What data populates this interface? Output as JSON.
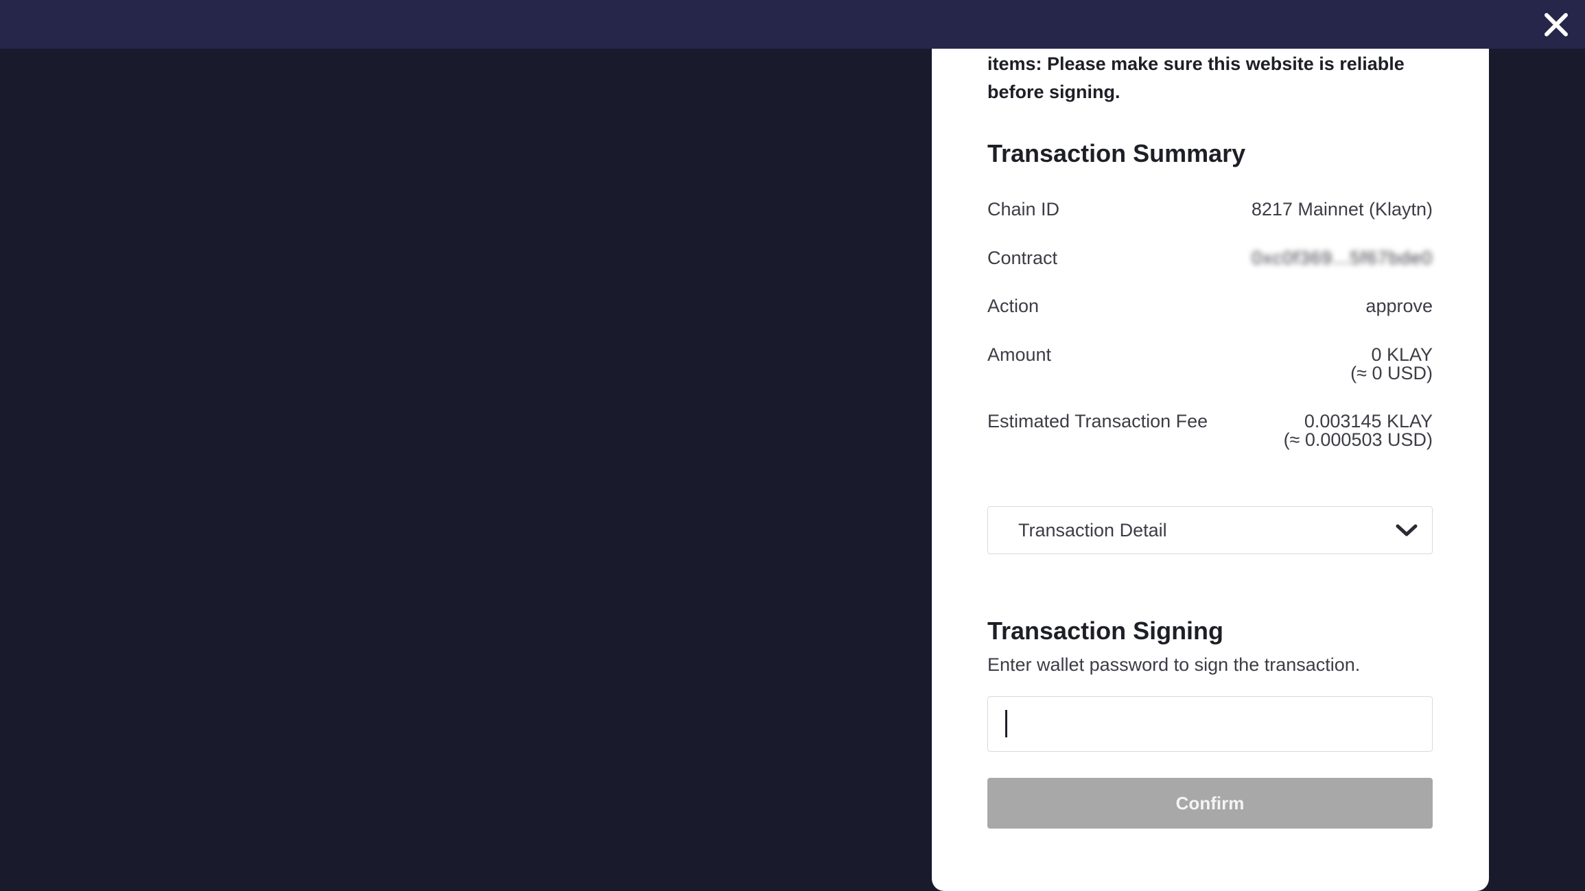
{
  "warning_text": "items: Please make sure this website is reliable before signing.",
  "summary": {
    "title": "Transaction Summary",
    "rows": [
      {
        "label": "Chain ID",
        "value": "8217 Mainnet (Klaytn)"
      },
      {
        "label": "Contract",
        "value": "0xc0f369...5f67bde0"
      },
      {
        "label": "Action",
        "value": "approve"
      },
      {
        "label": "Amount",
        "value": "0 KLAY",
        "value2": "(≈ 0 USD)"
      },
      {
        "label": "Estimated Transaction Fee",
        "value": "0.003145 KLAY",
        "value2": "(≈ 0.000503 USD)"
      }
    ]
  },
  "detail": {
    "label": "Transaction Detail"
  },
  "signing": {
    "title": "Transaction Signing",
    "subtitle": "Enter wallet password to sign the transaction.",
    "password_value": "",
    "confirm_label": "Confirm"
  },
  "colors": {
    "background": "#191a2c",
    "topbar": "#25264a",
    "panel": "#ffffff",
    "confirm_disabled": "#a8a8a8"
  },
  "icons": {
    "close": "close-icon",
    "dropdown": "chevron-down-icon"
  }
}
